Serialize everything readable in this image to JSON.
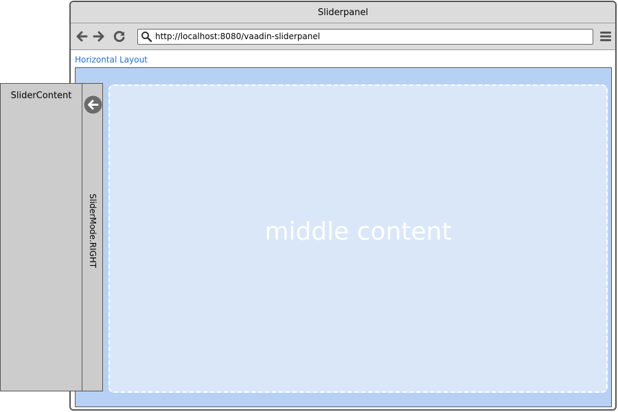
{
  "window": {
    "title": "Sliderpanel"
  },
  "toolbar": {
    "url": "http://localhost:8080/vaadin-sliderpanel",
    "icons": [
      "back-arrow-icon",
      "forward-arrow-icon",
      "reload-icon",
      "search-icon",
      "menu-icon"
    ]
  },
  "layout": {
    "label": "Horizontal Layout"
  },
  "middle": {
    "text": "middle content"
  },
  "slider": {
    "content_title": "SliderContent",
    "mode_label": "SliderMode.RIGHT",
    "toggle_icon": "arrow-left-circle-icon"
  },
  "colors": {
    "link": "#1f6fd1",
    "layout_bg": "#b7d1f5",
    "middle_bg": "#d9e7f9",
    "slider_bg": "#cccccc",
    "chrome": "#dcdcdc"
  }
}
